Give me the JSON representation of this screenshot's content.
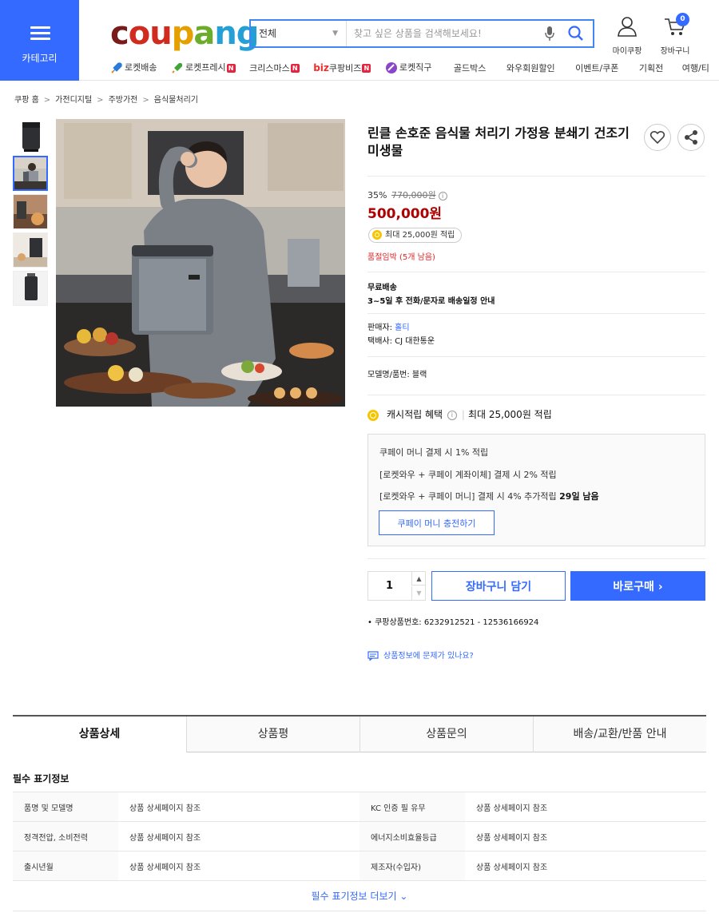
{
  "header": {
    "category_label": "카테고리",
    "logo": {
      "c": "c",
      "ou": "ou",
      "p": "p",
      "a": "a",
      "ng": "ng"
    },
    "search": {
      "category": "전체",
      "placeholder": "찾고 싶은 상품을 검색해보세요!"
    },
    "my_coupang": "마이쿠팡",
    "cart": {
      "label": "장바구니",
      "count": "0"
    },
    "nav": [
      {
        "label": "로켓배송",
        "icon": "rocket-icon"
      },
      {
        "label": "로켓프레시",
        "icon": "rocket-fresh-icon",
        "badge": "N"
      },
      {
        "label": "크리스마스",
        "badge": "N"
      },
      {
        "prefix": "biz",
        "label": "쿠팡비즈",
        "badge": "N"
      },
      {
        "label": "로켓직구",
        "icon": "rocket-global-icon"
      },
      {
        "label": "골드박스"
      },
      {
        "label": "와우회원할인"
      },
      {
        "label": "이벤트/쿠폰"
      },
      {
        "label": "기획전"
      },
      {
        "label": "여행/티"
      }
    ]
  },
  "breadcrumb": [
    "쿠팡 홈",
    "가전디지털",
    "주방가전",
    "음식물처리기"
  ],
  "product": {
    "title": "린클 손호준 음식물 처리기 가정용 분쇄기 건조기 미생물",
    "discount_rate": "35%",
    "original_price": "770,000원",
    "price": "500,000원",
    "reward": "최대 25,000원 적립",
    "stock": "품절임박 (5개 남음)",
    "shipping_title": "무료배송",
    "shipping_detail": "3~5일 후 전화/문자로 배송일정 안내",
    "seller_label": "판매자:",
    "seller": "홀티",
    "courier": "택배사: CJ 대한통운",
    "model": "모델명/품번: 블랙",
    "cash_label": "캐시적립 혜택",
    "cash_max": "최대 25,000원 적립",
    "pay_lines": {
      "l1": "쿠페이 머니 결제 시 1% 적립",
      "l2": "[로켓와우 + 쿠페이 계좌이체] 결제 시 2% 적립",
      "l3": "[로켓와우 + 쿠페이 머니] 결제 시 4% 추가적립",
      "l3_bold": "29일 남음"
    },
    "charge_btn": "쿠페이 머니 충전하기",
    "quantity": "1",
    "cart_btn": "장바구니 담기",
    "buy_btn": "바로구매",
    "product_number": "쿠팡상품번호: 6232912521 - 12536166924",
    "report": "상품정보에 문제가 있나요?"
  },
  "tabs": [
    "상품상세",
    "상품평",
    "상품문의",
    "배송/교환/반품 안내"
  ],
  "required_info": {
    "title": "필수 표기정보",
    "rows": [
      {
        "k1": "품명 및 모델명",
        "v1": "상품 상세페이지 참조",
        "k2": "KC 인증 필 유무",
        "v2": "상품 상세페이지 참조"
      },
      {
        "k1": "정격전압, 소비전력",
        "v1": "상품 상세페이지 참조",
        "k2": "에너지소비효율등급",
        "v2": "상품 상세페이지 참조"
      },
      {
        "k1": "출시년월",
        "v1": "상품 상세페이지 참조",
        "k2": "제조자(수입자)",
        "v2": "상품 상세페이지 참조"
      }
    ],
    "more": "필수 표기정보 더보기"
  },
  "colors": {
    "accent": "#346aff",
    "price": "#ae0000",
    "stock": "#e52528"
  }
}
